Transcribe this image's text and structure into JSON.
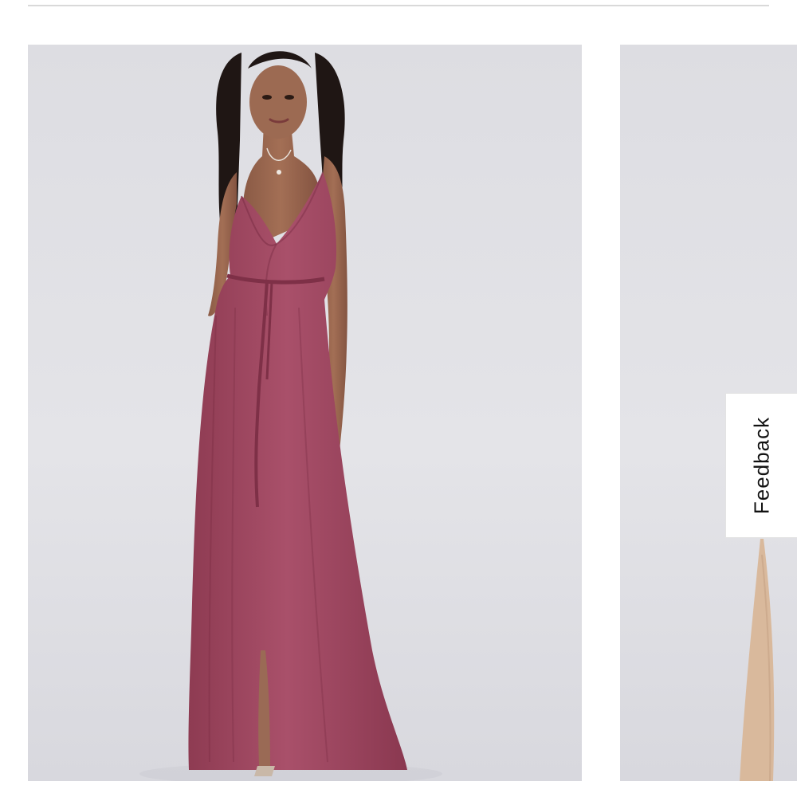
{
  "feedback": {
    "label": "Feedback"
  },
  "products": [
    {
      "image": "maroon-wrap-maxi-dress-photo",
      "dress_color": "#a24a62",
      "background_color": "#e0e0e5"
    },
    {
      "image": "champagne-dress-photo-partial",
      "dress_color": "#d9b99c",
      "background_color": "#e0e0e5"
    }
  ]
}
